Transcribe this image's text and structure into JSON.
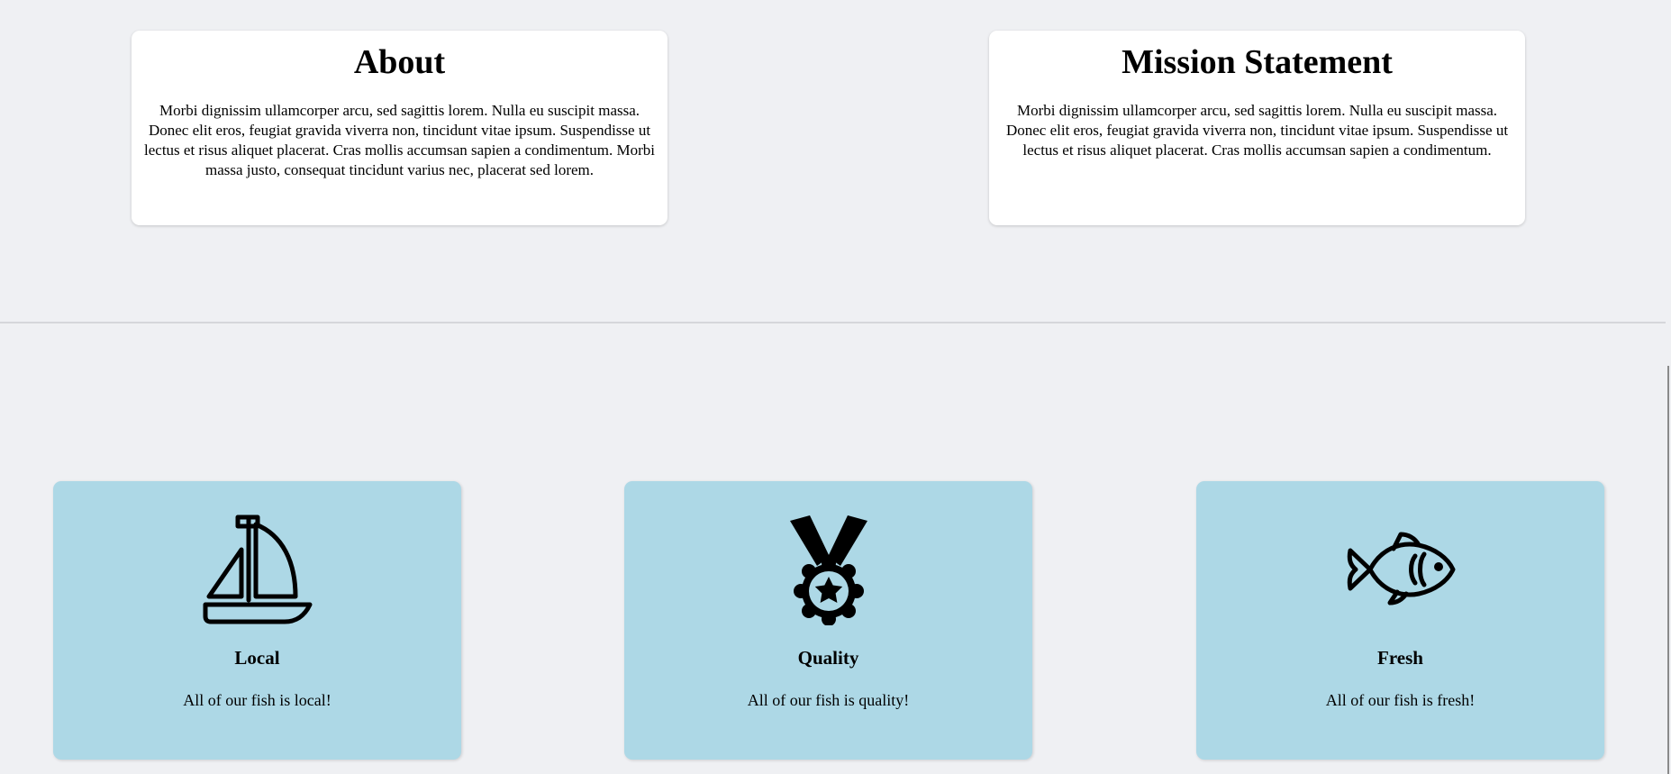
{
  "about": {
    "title": "About",
    "text": "Morbi dignissim ullamcorper arcu, sed sagittis lorem. Nulla eu suscipit massa. Donec elit eros, feugiat gravida viverra non, tincidunt vitae ipsum. Suspendisse ut lectus et risus aliquet placerat. Cras mollis accumsan sapien a condimentum. Morbi massa justo, consequat tincidunt varius nec, placerat sed lorem."
  },
  "mission": {
    "title": "Mission Statement",
    "text": "Morbi dignissim ullamcorper arcu, sed sagittis lorem. Nulla eu suscipit massa. Donec elit eros, feugiat gravida viverra non, tincidunt vitae ipsum. Suspendisse ut lectus et risus aliquet placerat. Cras mollis accumsan sapien a condimentum."
  },
  "features": [
    {
      "icon": "sailboat-icon",
      "title": "Local",
      "text": "All of our fish is local!"
    },
    {
      "icon": "medal-icon",
      "title": "Quality",
      "text": "All of our fish is quality!"
    },
    {
      "icon": "fish-icon",
      "title": "Fresh",
      "text": "All of our fish is fresh!"
    }
  ],
  "colors": {
    "background": "#eff0f3",
    "card": "#ffffff",
    "feature_card": "#add8e6",
    "divider": "#d5d6da"
  }
}
